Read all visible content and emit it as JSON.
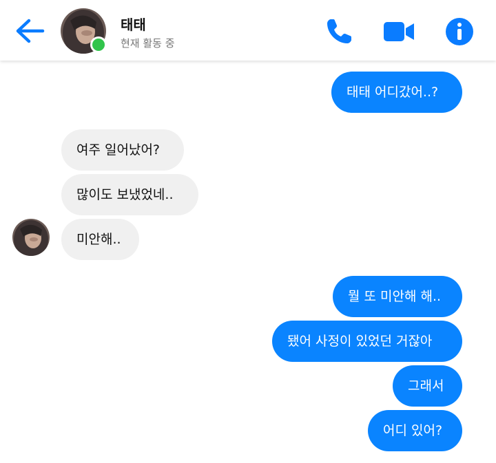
{
  "colors": {
    "accent": "#0A7CFF",
    "sent_bubble": "#0A84FF",
    "received_bubble": "#F0F0F0",
    "online": "#31C44B"
  },
  "header": {
    "back_icon": "arrow-left-icon",
    "contact_name": "태태",
    "contact_status": "현재 활동 중",
    "call_icon": "phone-icon",
    "video_icon": "video-camera-icon",
    "info_icon": "info-icon"
  },
  "messages": [
    {
      "direction": "sent",
      "text": "태태 어디갔어..?"
    },
    {
      "direction": "received",
      "text": "여주 일어났어?"
    },
    {
      "direction": "received",
      "text": "많이도 보냈었네.."
    },
    {
      "direction": "received",
      "text": "미안해.."
    },
    {
      "direction": "sent",
      "text": "뭘 또 미안해 해.."
    },
    {
      "direction": "sent",
      "text": "됐어 사정이 있었던 거잖아"
    },
    {
      "direction": "sent",
      "text": "그래서"
    },
    {
      "direction": "sent",
      "text": "어디 있어?"
    }
  ]
}
